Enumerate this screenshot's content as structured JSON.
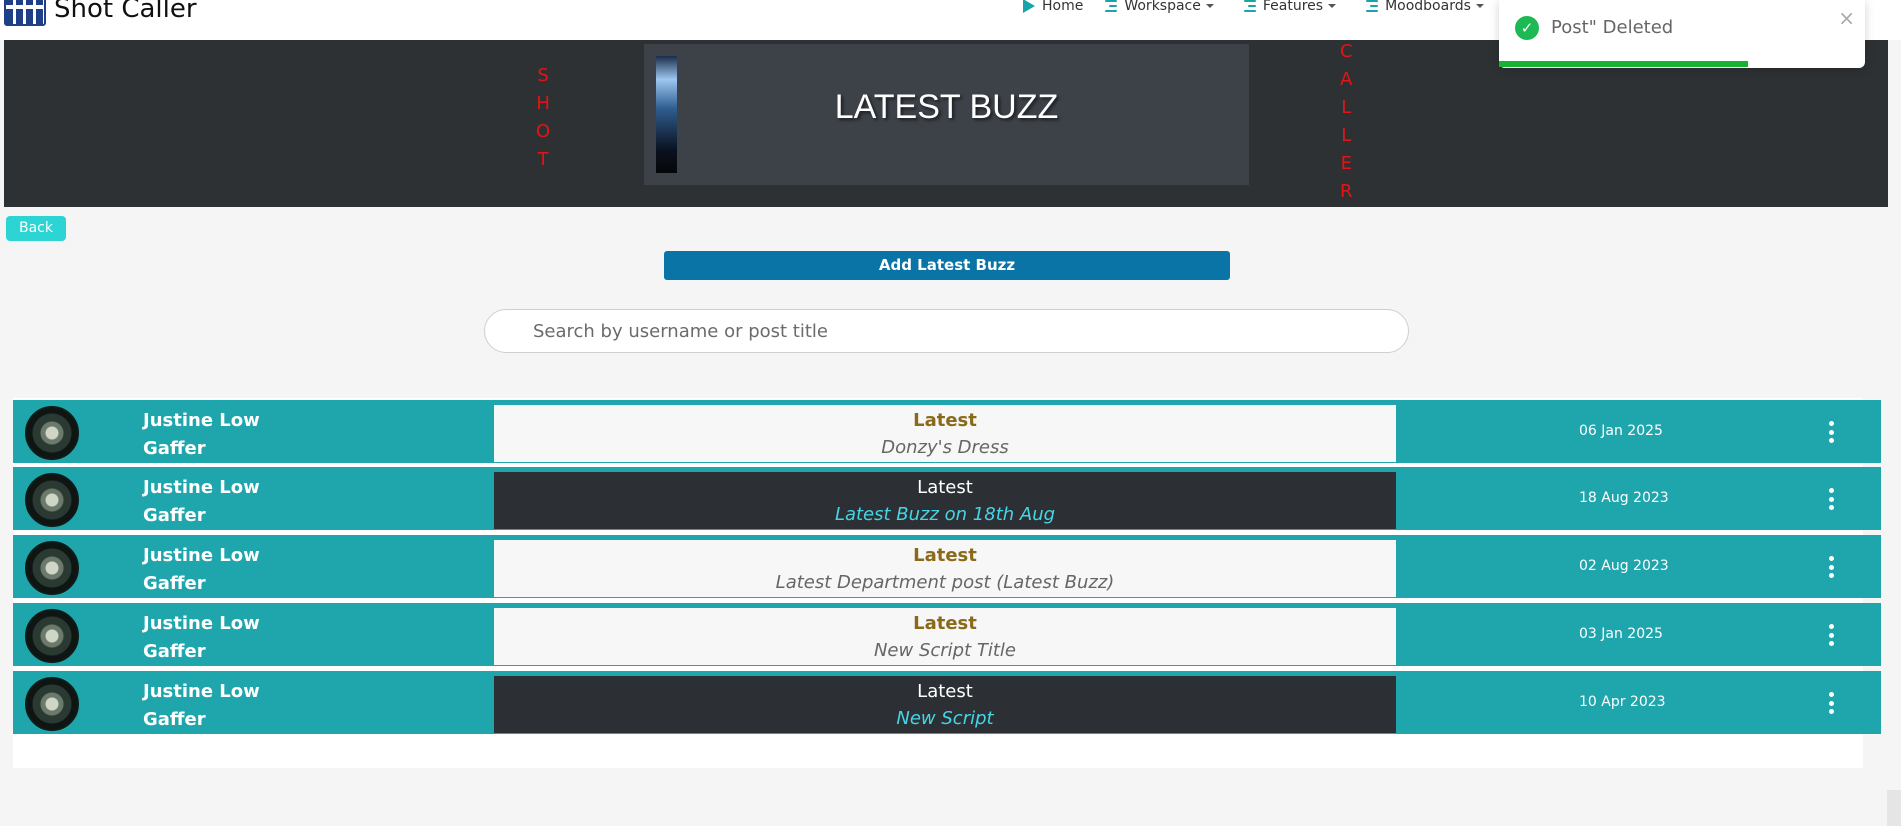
{
  "nav": {
    "brand": "Shot Caller",
    "items": [
      {
        "label": "Home"
      },
      {
        "label": "Workspace"
      },
      {
        "label": "Features"
      },
      {
        "label": "Moodboards"
      }
    ]
  },
  "toast": {
    "message": "Post\" Deleted",
    "close": "×",
    "progress": 0.68
  },
  "banner": {
    "title": "LATEST BUZZ",
    "left_letters": [
      "S",
      "H",
      "O",
      "T"
    ],
    "right_letters": [
      "C",
      "A",
      "L",
      "L",
      "E",
      "R"
    ]
  },
  "back_label": "Back",
  "add_label": "Add Latest Buzz",
  "search": {
    "placeholder": "Search by username or post title"
  },
  "posts": [
    {
      "name": "Justine Low",
      "role": "Gaffer",
      "heading": "Latest",
      "title": "Donzy's Dress",
      "date": "06 Jan 2025",
      "theme": "light"
    },
    {
      "name": "Justine Low",
      "role": "Gaffer",
      "heading": "Latest",
      "title": "Latest Buzz on 18th Aug",
      "date": "18 Aug 2023",
      "theme": "dark"
    },
    {
      "name": "Justine Low",
      "role": "Gaffer",
      "heading": "Latest",
      "title": "Latest Department post (Latest Buzz)",
      "date": "02 Aug 2023",
      "theme": "light"
    },
    {
      "name": "Justine Low",
      "role": "Gaffer",
      "heading": "Latest",
      "title": "New Script Title",
      "date": "03 Jan 2025",
      "theme": "light"
    },
    {
      "name": "Justine Low",
      "role": "Gaffer",
      "heading": "Latest",
      "title": "New Script",
      "date": "10 Apr 2023",
      "theme": "dark"
    }
  ],
  "colors": {
    "row": "#1fa6ad",
    "add_button": "#0a74a6",
    "back_button": "#2dd4d4",
    "banner": "#2e3133",
    "letters": "#e01616"
  }
}
